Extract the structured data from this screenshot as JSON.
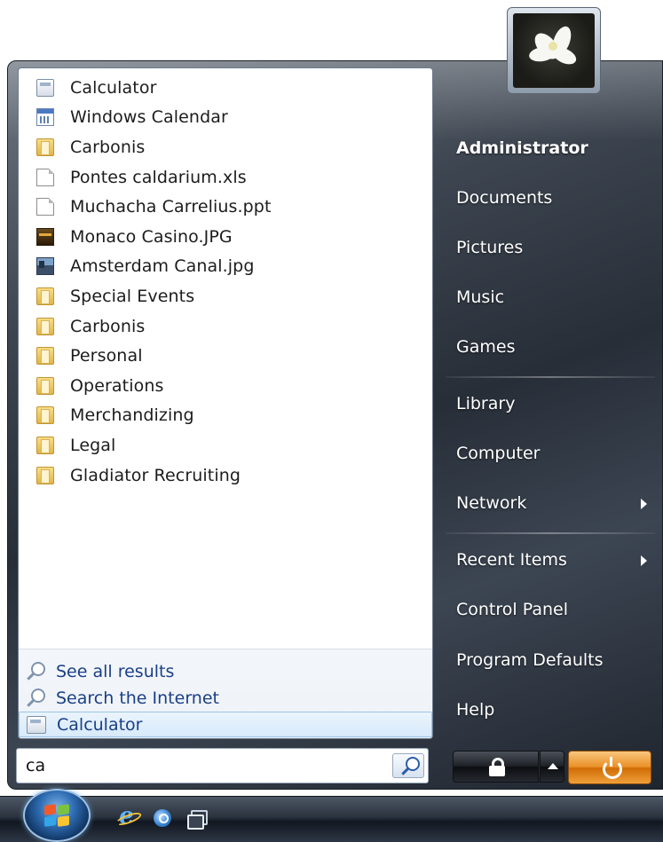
{
  "left_pane": {
    "results": [
      {
        "label": "Calculator",
        "icon": "calculator-icon"
      },
      {
        "label": "Windows Calendar",
        "icon": "calendar-icon"
      },
      {
        "label": "Carbonis",
        "icon": "folder-icon"
      },
      {
        "label": "Pontes caldarium.xls",
        "icon": "document-icon"
      },
      {
        "label": "Muchacha Carrelius.ppt",
        "icon": "document-icon"
      },
      {
        "label": "Monaco Casino.JPG",
        "icon": "photo-icon"
      },
      {
        "label": "Amsterdam Canal.jpg",
        "icon": "photo-icon"
      },
      {
        "label": "Special Events",
        "icon": "folder-icon"
      },
      {
        "label": "Carbonis",
        "icon": "folder-icon"
      },
      {
        "label": "Personal",
        "icon": "folder-icon"
      },
      {
        "label": "Operations",
        "icon": "folder-icon"
      },
      {
        "label": "Merchandizing",
        "icon": "folder-icon"
      },
      {
        "label": "Legal",
        "icon": "folder-icon"
      },
      {
        "label": "Gladiator Recruiting",
        "icon": "folder-icon"
      }
    ],
    "bottom_links": {
      "see_all": "See all results",
      "search_internet": "Search the Internet",
      "selected_program": "Calculator"
    }
  },
  "search": {
    "value": "ca"
  },
  "right_pane": {
    "user_name": "Administrator",
    "items": {
      "documents": "Documents",
      "pictures": "Pictures",
      "music": "Music",
      "games": "Games",
      "library": "Library",
      "computer": "Computer",
      "network": "Network",
      "recent_items": "Recent Items",
      "control_panel": "Control Panel",
      "program_defaults": "Program Defaults",
      "help": "Help"
    }
  },
  "colors": {
    "link_blue": "#1a3f87",
    "power_orange": "#ea9028",
    "selection_blue": "#d8eafb"
  }
}
